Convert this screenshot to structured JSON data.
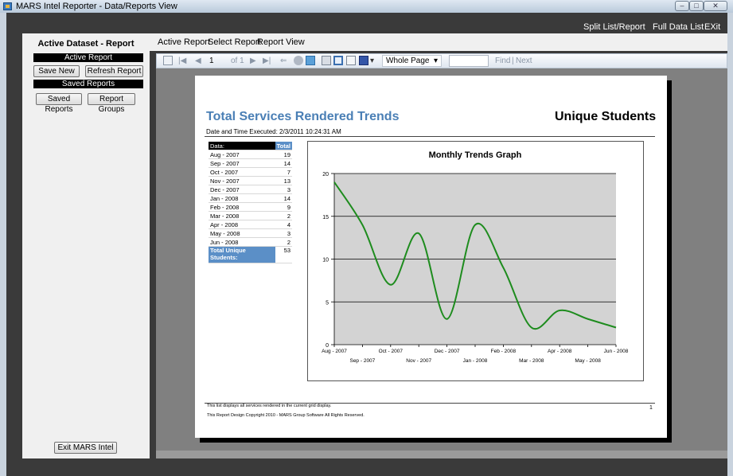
{
  "window": {
    "title": "MARS Intel Reporter - Data/Reports View"
  },
  "top_menu": [
    "Split List/Report",
    "Full Data List",
    "EXit"
  ],
  "left_panel": {
    "title": "Active Dataset - Report",
    "active_report_header": "Active Report",
    "save_new": "Save New",
    "refresh_report": "Refresh Report",
    "saved_reports_header": "Saved Reports",
    "saved_reports_button": "Saved Reports",
    "report_groups": "Report Groups",
    "exit": "Exit MARS Intel"
  },
  "report_menu": [
    "Active Report",
    "Select Report",
    "Report View"
  ],
  "toolbar": {
    "page": "1",
    "of": "of 1",
    "zoom": "Whole Page",
    "find": "Find",
    "next": "Next"
  },
  "report": {
    "title": "Total Services Rendered Trends",
    "subtitle": "Unique Students",
    "date_executed": "Date and Time Executed: 2/3/2011 10:24:31 AM",
    "table_header": {
      "label": "Data:",
      "value": "Total"
    },
    "rows": [
      {
        "label": "Aug - 2007",
        "value": "19"
      },
      {
        "label": "Sep - 2007",
        "value": "14"
      },
      {
        "label": "Oct - 2007",
        "value": "7"
      },
      {
        "label": "Nov - 2007",
        "value": "13"
      },
      {
        "label": "Dec - 2007",
        "value": "3"
      },
      {
        "label": "Jan - 2008",
        "value": "14"
      },
      {
        "label": "Feb - 2008",
        "value": "9"
      },
      {
        "label": "Mar - 2008",
        "value": "2"
      },
      {
        "label": "Apr - 2008",
        "value": "4"
      },
      {
        "label": "May - 2008",
        "value": "3"
      },
      {
        "label": "Jun - 2008",
        "value": "2"
      }
    ],
    "total_label": "Total Unique Students:",
    "total_value": "53",
    "footer_line1": "This list displays all services rendered in the current grid display.",
    "footer_line2": "This Report Design Copyright 2010 - MARS Group Software All Rights Reserved.",
    "page_number": "1"
  },
  "chart_data": {
    "type": "line",
    "title": "Monthly Trends Graph",
    "categories": [
      "Aug - 2007",
      "Sep - 2007",
      "Oct - 2007",
      "Nov - 2007",
      "Dec - 2007",
      "Jan - 2008",
      "Feb - 2008",
      "Mar - 2008",
      "Apr - 2008",
      "May - 2008",
      "Jun - 2008"
    ],
    "values": [
      19,
      14,
      7,
      13,
      3,
      14,
      9,
      2,
      4,
      3,
      2
    ],
    "ylim": [
      0,
      20
    ],
    "yticks": [
      0,
      5,
      10,
      15,
      20
    ],
    "grid": true,
    "line_color": "#1e8c1e",
    "plot_bg": "#d3d3d3"
  }
}
